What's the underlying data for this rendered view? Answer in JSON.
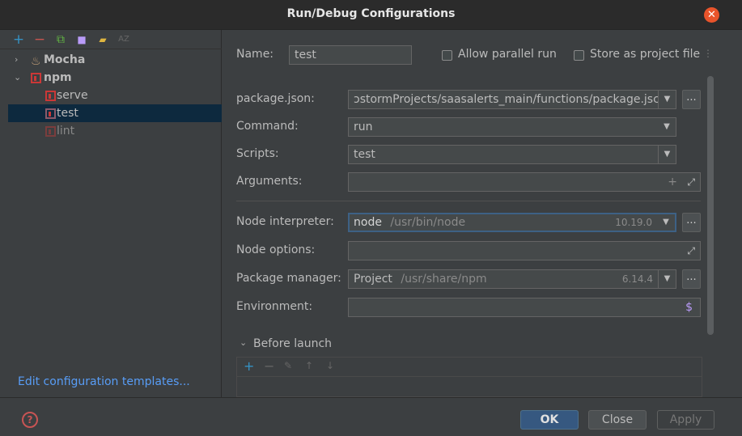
{
  "window": {
    "title": "Run/Debug Configurations"
  },
  "toolbar": {
    "add": "+",
    "remove": "−",
    "copy": "⧉",
    "save": "■",
    "folder": "▰",
    "sort": "AZ"
  },
  "tree": {
    "groups": [
      {
        "label": "Mocha",
        "expanded": false
      },
      {
        "label": "npm",
        "expanded": true,
        "items": [
          "serve",
          "test",
          "lint"
        ]
      }
    ]
  },
  "edit_templates": "Edit configuration templates...",
  "form": {
    "name_label": "Name:",
    "name_value": "test",
    "allow_parallel": "Allow parallel run",
    "store_project": "Store as project file",
    "package_json_label": "package.json:",
    "package_json_value": "ɔstormProjects/saasalerts_main/functions/package.jsc",
    "command_label": "Command:",
    "command_value": "run",
    "scripts_label": "Scripts:",
    "scripts_value": "test",
    "arguments_label": "Arguments:",
    "node_interpreter_label": "Node interpreter:",
    "node_interpreter_value": "node",
    "node_interpreter_path": "/usr/bin/node",
    "node_interpreter_version": "10.19.0",
    "node_options_label": "Node options:",
    "package_manager_label": "Package manager:",
    "package_manager_value": "Project",
    "package_manager_path": "/usr/share/npm",
    "package_manager_version": "6.14.4",
    "environment_label": "Environment:",
    "dots": "...",
    "before_launch": "Before launch"
  },
  "buttons": {
    "ok": "OK",
    "close": "Close",
    "apply": "Apply",
    "help": "?"
  }
}
